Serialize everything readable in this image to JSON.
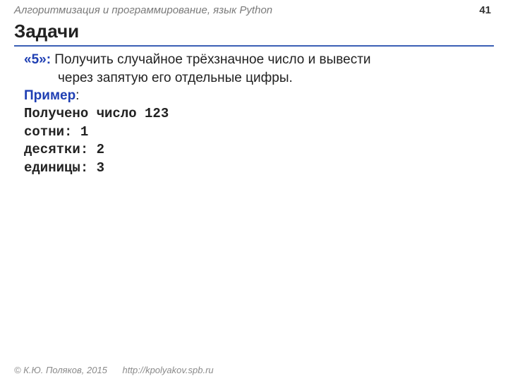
{
  "header": {
    "course": "Алгоритмизация и программирование, язык Python",
    "page_number": "41"
  },
  "title": "Задачи",
  "task": {
    "grade_label": "«5»:",
    "line1": " Получить случайное трёхзначное число и вывести",
    "line2": "через запятую его отдельные цифры."
  },
  "example": {
    "label": "Пример",
    "colon": ":",
    "lines": [
      "Получено число 123",
      "сотни: 1",
      "десятки: 2",
      "единицы: 3"
    ]
  },
  "footer": {
    "copyright": "© К.Ю. Поляков, 2015",
    "url": "http://kpolyakov.spb.ru"
  }
}
